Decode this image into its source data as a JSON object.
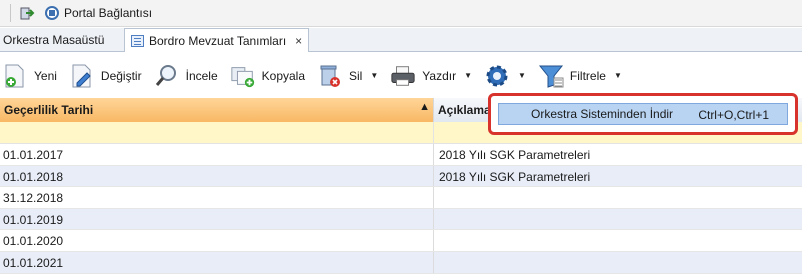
{
  "topbar": {
    "portal_label": "Portal Bağlantısı"
  },
  "tabs": [
    {
      "label": "Orkestra Masaüstü",
      "active": false
    },
    {
      "label": "Bordro Mevzuat Tanımları",
      "active": true,
      "close": "×"
    }
  ],
  "toolbar": {
    "new_label": "Yeni",
    "edit_label": "Değiştir",
    "view_label": "İncele",
    "copy_label": "Kopyala",
    "delete_label": "Sil",
    "print_label": "Yazdır",
    "filter_label": "Filtrele"
  },
  "grid": {
    "col_date": "Geçerlilik Tarihi",
    "col_desc": "Açıklama",
    "rows": [
      {
        "date": "01.01.2017",
        "desc": "2018 Yılı SGK Parametreleri"
      },
      {
        "date": "01.01.2018",
        "desc": "2018 Yılı SGK Parametreleri"
      },
      {
        "date": "31.12.2018",
        "desc": ""
      },
      {
        "date": "01.01.2019",
        "desc": ""
      },
      {
        "date": "01.01.2020",
        "desc": ""
      },
      {
        "date": "01.01.2021",
        "desc": ""
      }
    ]
  },
  "popup": {
    "item_label": "Orkestra Sisteminden İndir",
    "item_shortcut": "Ctrl+O,Ctrl+1"
  },
  "colors": {
    "header_accent": "#f8b864",
    "filter_row": "#fff7c8",
    "row_alt": "#e8edf8",
    "popup_highlight": "#b9d4f3",
    "popup_border": "#d7332c"
  }
}
